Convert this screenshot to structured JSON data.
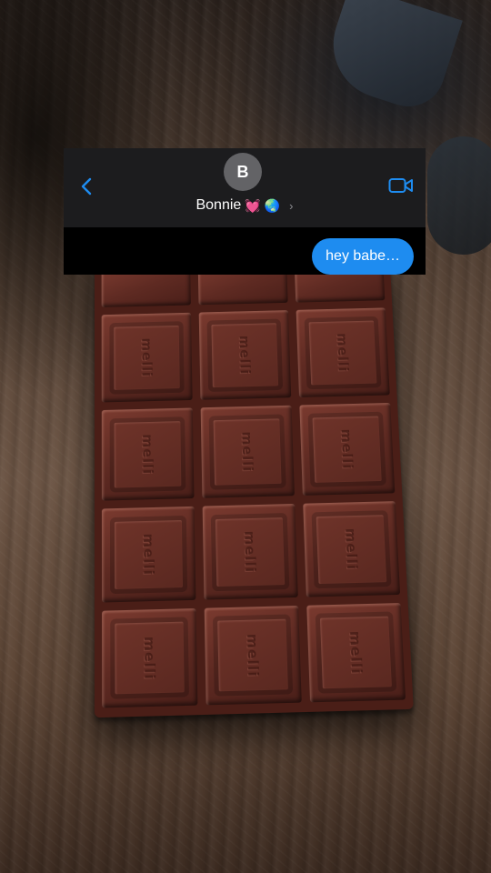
{
  "chat": {
    "contact_initial": "B",
    "contact_name": "Bonnie",
    "contact_emoji_heart": "💓",
    "contact_emoji_globe": "🌏",
    "chevron": "›",
    "message": "hey babe…",
    "accent_color": "#1e8cf0",
    "icons": [
      "chevron-left-icon",
      "video-camera-icon"
    ]
  },
  "chocolate": {
    "embossed_text": "melli"
  }
}
